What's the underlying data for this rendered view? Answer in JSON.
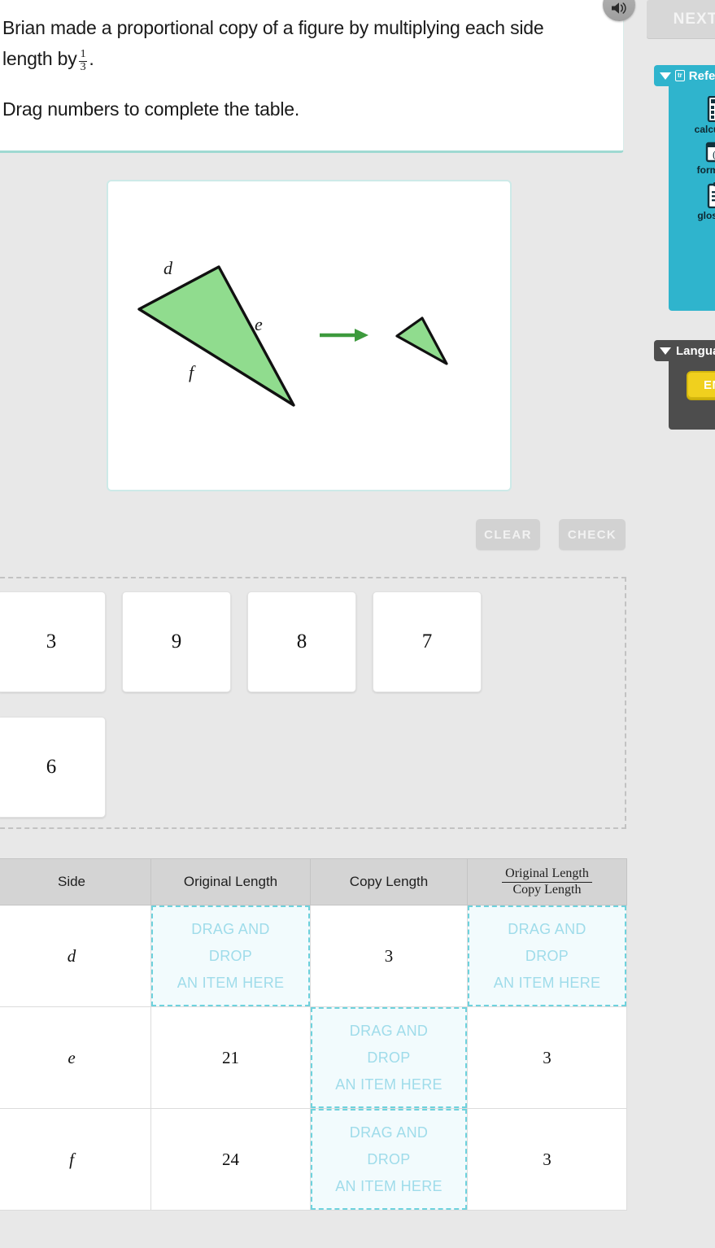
{
  "question": {
    "line1_before": "Brian made a proportional copy of a figure by multiplying each side length by",
    "fraction_numerator": "1",
    "fraction_denominator": "3",
    "line1_after": ".",
    "line2": "Drag numbers to complete the table."
  },
  "speaker": {
    "icon": "speaker-icon"
  },
  "rail": {
    "next_label": "NEXT",
    "reference": {
      "tab_label": "Reference",
      "tab_badge": "tr",
      "items": [
        {
          "icon": "calculator-icon",
          "label": "calculator"
        },
        {
          "icon": "formula-icon",
          "label": "formulas"
        },
        {
          "icon": "glossary-icon",
          "label": "glossary"
        }
      ]
    },
    "language": {
      "tab_label": "Language",
      "selected": "ENG"
    }
  },
  "figure": {
    "labels": {
      "d": "d",
      "e": "e",
      "f": "f"
    },
    "fill_color": "#90DC8E",
    "stroke_color": "#111111",
    "arrow_color": "#3d9a3d"
  },
  "actions": {
    "clear_label": "CLEAR",
    "check_label": "CHECK"
  },
  "tile_bank": {
    "tiles": [
      "3",
      "9",
      "8",
      "7",
      "6"
    ]
  },
  "table": {
    "headers": {
      "side": "Side",
      "original": "Original Length",
      "copy": "Copy Length",
      "ratio_num": "Original Length",
      "ratio_den": "Copy Length"
    },
    "dropzone_placeholder_l1": "DRAG AND",
    "dropzone_placeholder_l2": "DROP",
    "dropzone_placeholder_l3": "AN ITEM HERE",
    "rows": [
      {
        "side": "d",
        "original": "",
        "original_is_drop": true,
        "copy": "3",
        "copy_is_drop": false,
        "ratio": "",
        "ratio_is_drop": true
      },
      {
        "side": "e",
        "original": "21",
        "original_is_drop": false,
        "copy": "",
        "copy_is_drop": true,
        "ratio": "3",
        "ratio_is_drop": false
      },
      {
        "side": "f",
        "original": "24",
        "original_is_drop": false,
        "copy": "",
        "copy_is_drop": true,
        "ratio": "3",
        "ratio_is_drop": false
      }
    ]
  },
  "colors": {
    "accent_teal": "#2fb4cd",
    "dropzone_border": "#6ed2dd",
    "dropzone_text": "#9fdcea",
    "card_border": "#9fd9d2",
    "yellow": "#f0d01e"
  }
}
